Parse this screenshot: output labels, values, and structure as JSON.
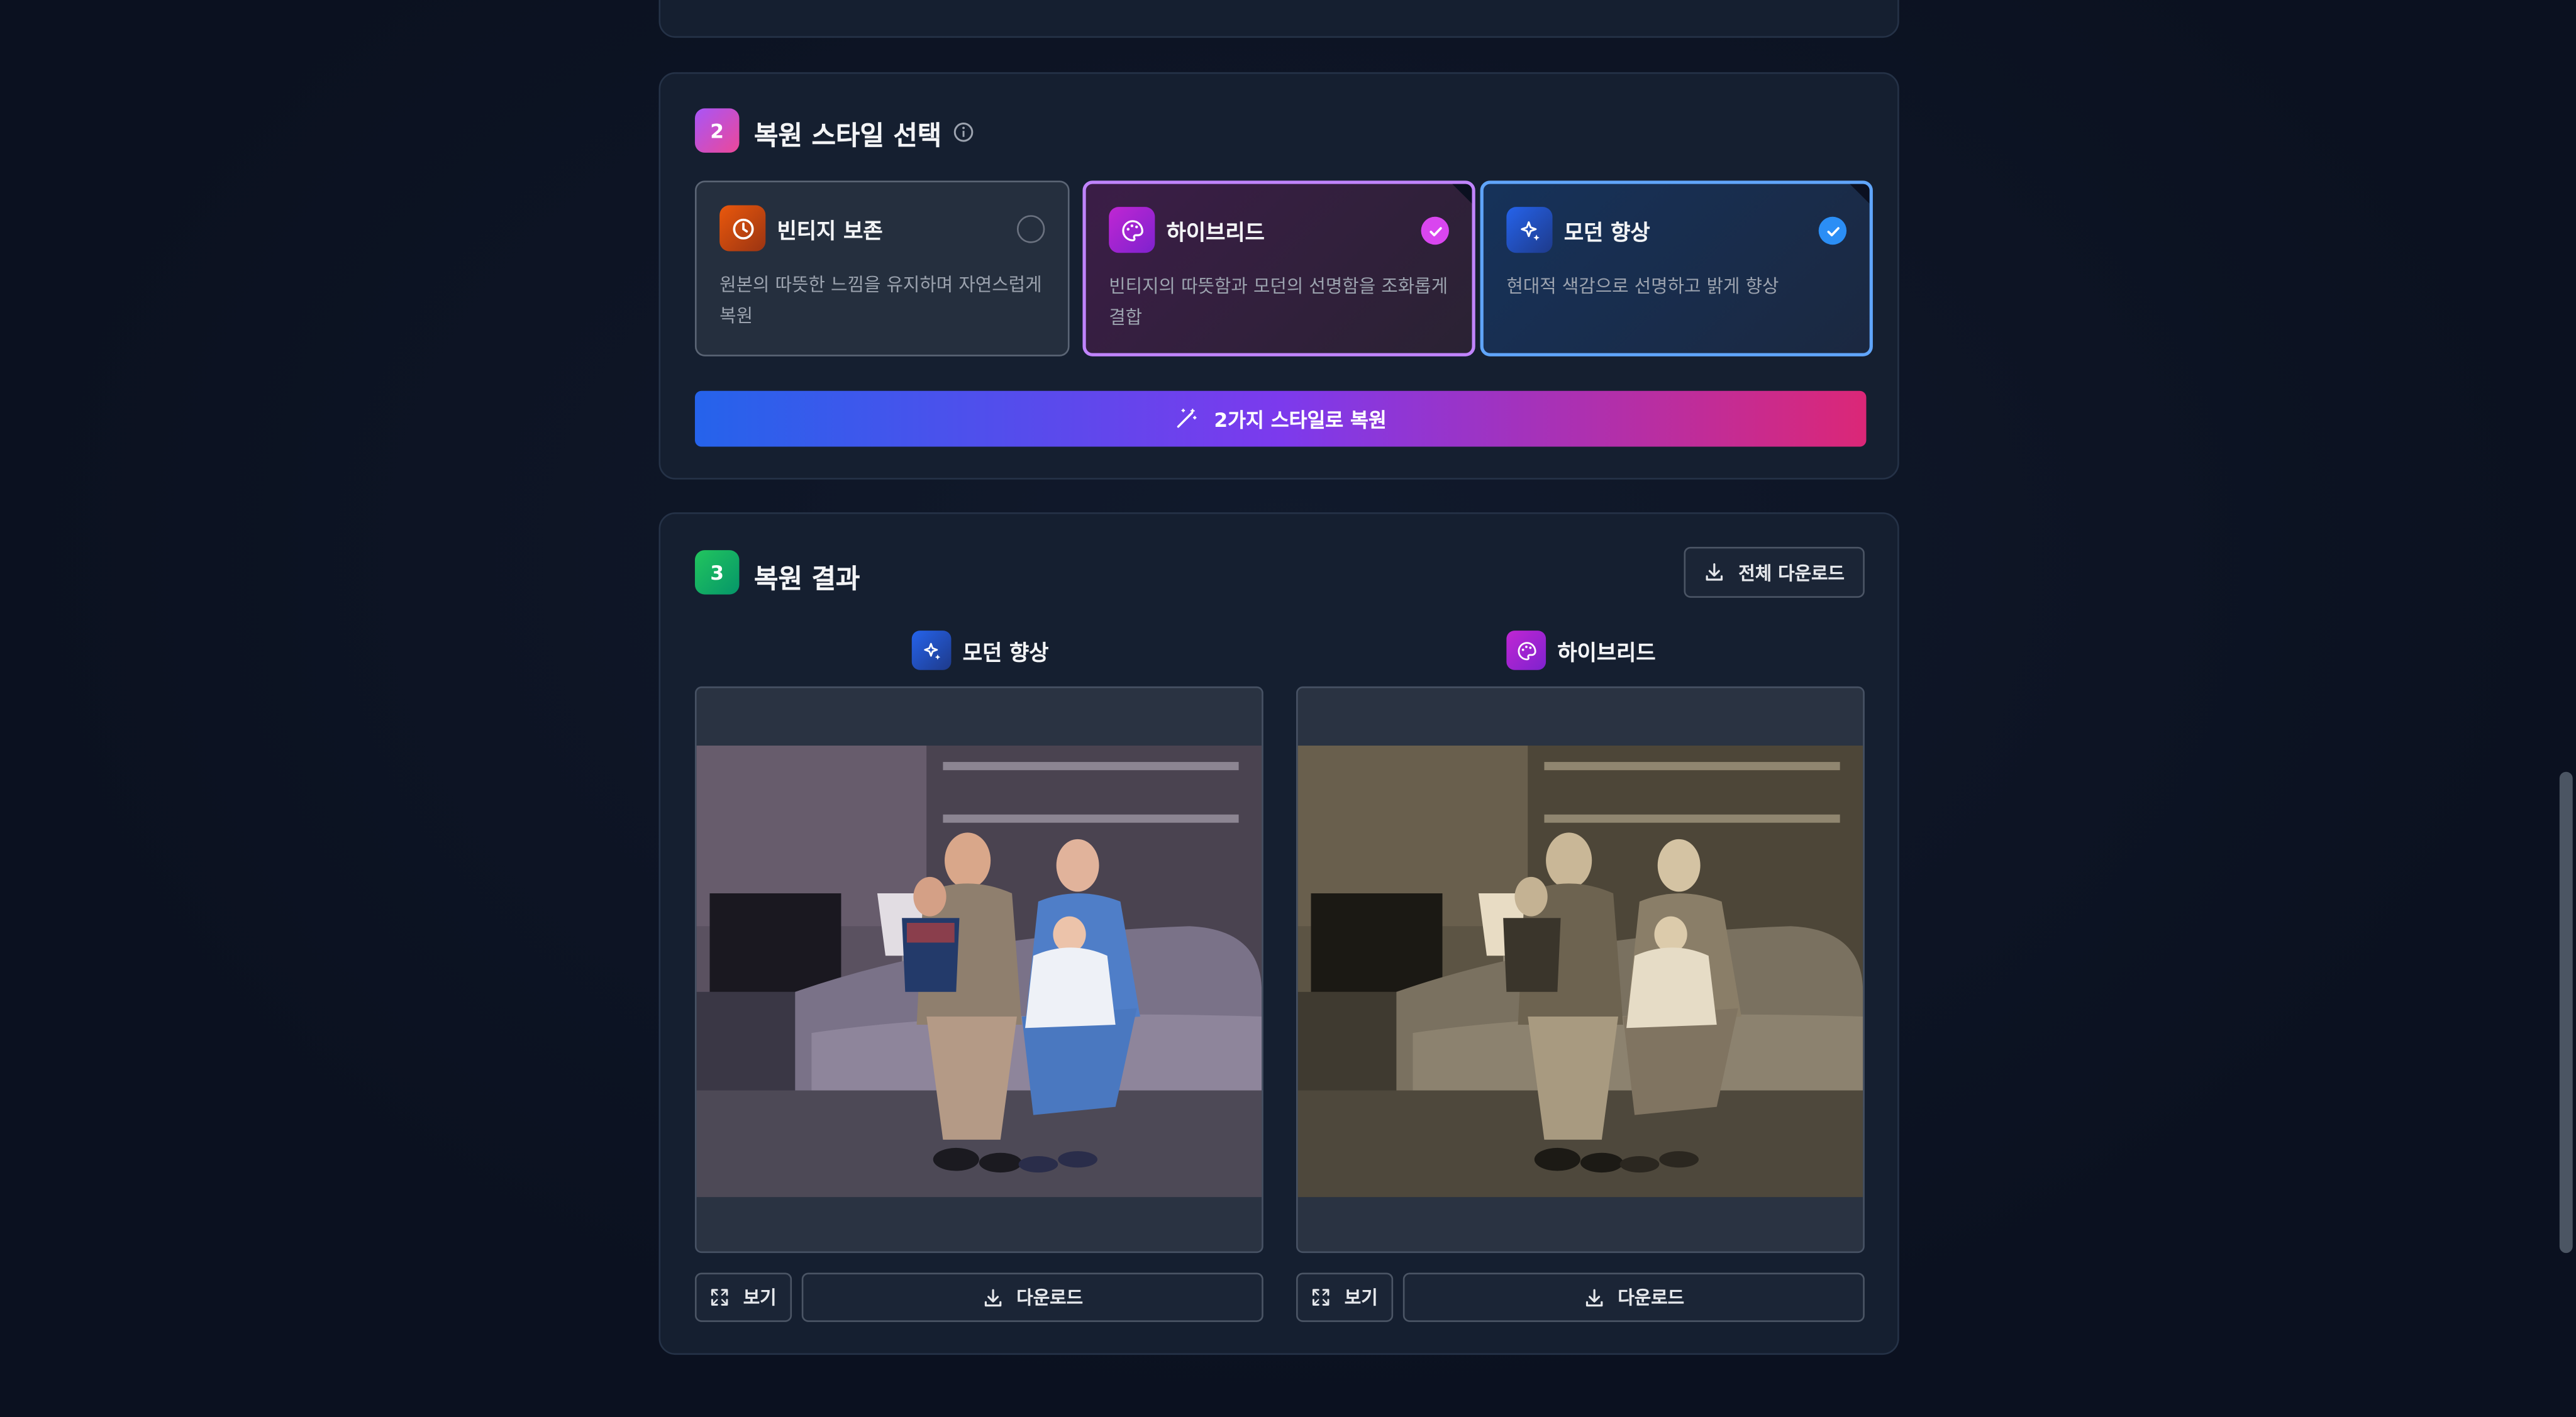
{
  "style_section": {
    "step_number": "2",
    "title": "복원 스타일 선택",
    "info_icon": "info-icon",
    "options": [
      {
        "icon": "clock-icon",
        "title": "빈티지 보존",
        "description": "원본의 따뜻한 느낌을 유지하며 자연스럽게 복원",
        "selected": false,
        "color": "#c2410c"
      },
      {
        "icon": "palette-icon",
        "title": "하이브리드",
        "description": "빈티지의 따뜻함과 모던의 선명함을 조화롭게 결합",
        "selected": true,
        "color": "#c026d3"
      },
      {
        "icon": "sparkles-icon",
        "title": "모던 향상",
        "description": "현대적 색감으로 선명하고 밝게 향상",
        "selected": true,
        "color": "#3b82f6"
      }
    ],
    "restore_button_label": "2가지 스타일로 복원",
    "restore_button_icon": "magic-wand-icon"
  },
  "results_section": {
    "step_number": "3",
    "title": "복원 결과",
    "download_all_label": "전체 다운로드",
    "results": [
      {
        "icon": "sparkles-icon",
        "label": "모던 향상",
        "view_label": "보기",
        "download_label": "다운로드",
        "tone": "color"
      },
      {
        "icon": "palette-icon",
        "label": "하이브리드",
        "view_label": "보기",
        "download_label": "다운로드",
        "tone": "sepia"
      }
    ]
  },
  "colors": {
    "background": "#0b1120",
    "card": "#151f30",
    "accent_pink": "#db2777",
    "accent_blue": "#2563eb",
    "accent_green": "#16a34a"
  }
}
